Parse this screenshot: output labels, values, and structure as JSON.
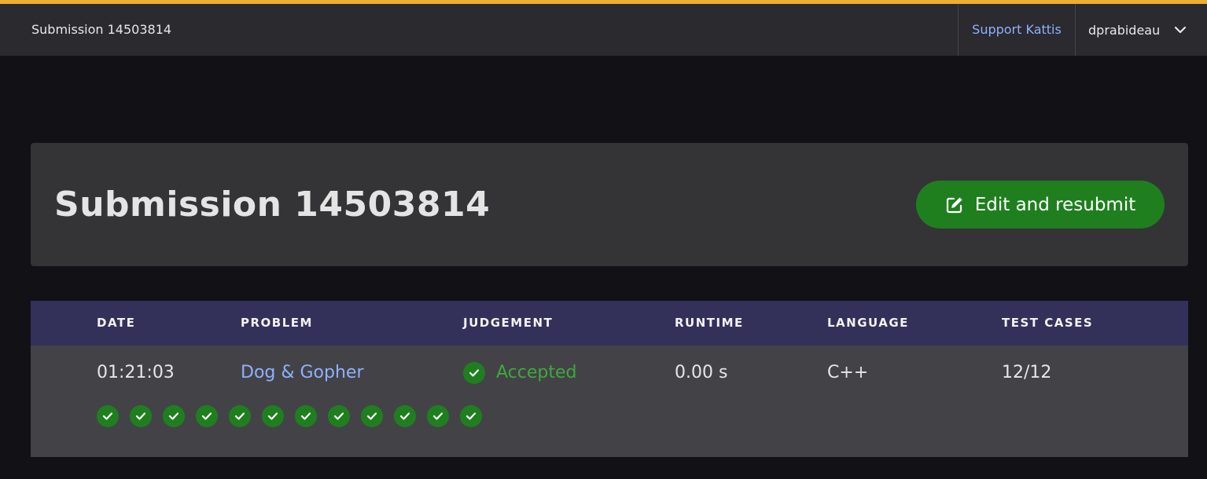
{
  "colors": {
    "accent": "#f0ad2e",
    "topbar": "#2a2a2f",
    "link": "#8fb0ff",
    "success": "#1f7f1f",
    "accepted_text": "#3fa83f",
    "table_header": "#33305a"
  },
  "topbar": {
    "title": "Submission 14503814",
    "support_link": "Support Kattis",
    "username": "dprabideau",
    "user_menu_icon": "chevron-down-icon"
  },
  "header": {
    "title": "Submission 14503814",
    "resubmit_label": "Edit and resubmit",
    "resubmit_icon": "edit-icon"
  },
  "table": {
    "columns": [
      "DATE",
      "PROBLEM",
      "JUDGEMENT",
      "RUNTIME",
      "LANGUAGE",
      "TEST CASES"
    ],
    "row": {
      "date": "01:21:03",
      "problem": "Dog & Gopher",
      "judgement": "Accepted",
      "judgement_icon": "check-circle-icon",
      "runtime": "0.00 s",
      "language": "C++",
      "test_cases": "12/12"
    },
    "test_results": [
      "accepted",
      "accepted",
      "accepted",
      "accepted",
      "accepted",
      "accepted",
      "accepted",
      "accepted",
      "accepted",
      "accepted",
      "accepted",
      "accepted"
    ]
  }
}
